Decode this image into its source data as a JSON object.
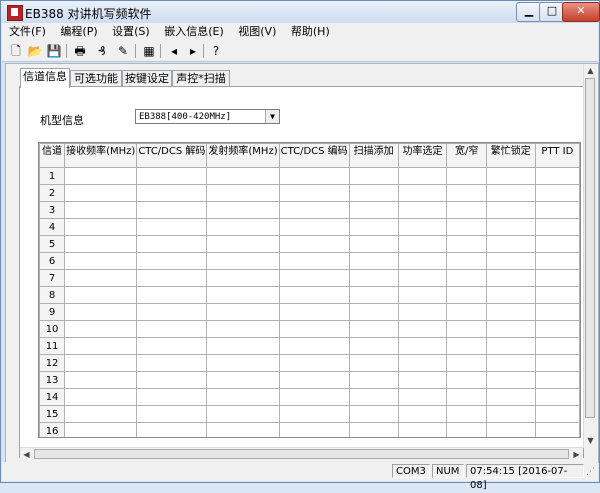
{
  "window": {
    "title": "EB388 对讲机写频软件",
    "buttons": {
      "minimize": "▁",
      "maximize": "□",
      "close": "✕"
    }
  },
  "menu": [
    "文件(F)",
    "编程(P)",
    "设置(S)",
    "嵌入信息(E)",
    "视图(V)",
    "帮助(H)"
  ],
  "toolbar": {
    "icons": [
      "new-file-icon",
      "open-folder-icon",
      "save-icon",
      "print-icon",
      "read-radio-icon",
      "write-radio-icon",
      "screen-icon",
      "upload-icon",
      "download-icon",
      "help-icon"
    ],
    "glyphs": [
      "🗋",
      "📂",
      "💾",
      "🖶",
      "₰",
      "✎",
      "▦",
      "◂",
      "▸",
      "?"
    ]
  },
  "tabs": [
    "信道信息",
    "可选功能",
    "按键设定",
    "声控*扫描"
  ],
  "model": {
    "label": "机型信息",
    "value": "EB388[400-420MHz]"
  },
  "table": {
    "columns": [
      "信道",
      "接收频率(MHz)",
      "CTC/DCS 解码",
      "发射频率(MHz)",
      "CTC/DCS 编码",
      "扫描添加",
      "功率选定",
      "宽/窄",
      "繁忙锁定",
      "PTT ID"
    ],
    "rows": [
      "1",
      "2",
      "3",
      "4",
      "5",
      "6",
      "7",
      "8",
      "9",
      "10",
      "11",
      "12",
      "13",
      "14",
      "15",
      "16"
    ]
  },
  "status": {
    "port": "COM3",
    "numlock": "NUM",
    "datetime": "07:54:15 [2016-07-08]"
  }
}
